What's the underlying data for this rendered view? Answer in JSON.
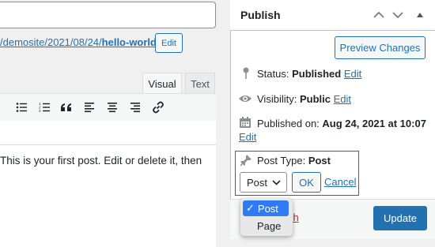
{
  "editor": {
    "permalink_prefix": "/demosite/2021/08/24/",
    "permalink_slug": "hello-world",
    "permalink_suffix": "/",
    "edit_label": "Edit",
    "tabs": {
      "visual": "Visual",
      "text": "Text"
    },
    "toolbar_icons": [
      "bulleted-list-icon",
      "numbered-list-icon",
      "blockquote-icon",
      "align-left-icon",
      "align-center-icon",
      "align-right-icon",
      "link-icon"
    ],
    "content": "This is your first post. Edit or delete it, then"
  },
  "publish": {
    "title": "Publish",
    "preview_label": "Preview Changes",
    "status_label": "Status:",
    "status_value": "Published",
    "visibility_label": "Visibility:",
    "visibility_value": "Public",
    "published_label": "Published on:",
    "published_value": "Aug 24, 2021 at 10:07",
    "edit_link": "Edit",
    "post_type_label": "Post Type:",
    "post_type_value": "Post",
    "select_value": "Post",
    "ok_label": "OK",
    "cancel_label": "Cancel",
    "trash_fragment": "sh",
    "update_label": "Update"
  },
  "dropdown": {
    "options": [
      "Post",
      "Page"
    ],
    "selected_index": 0,
    "check": "✓"
  },
  "colors": {
    "accent": "#2271b1",
    "highlight_border": "#b32d55",
    "dropdown_selected": "#2f7bf5",
    "trash": "#b32d2e"
  }
}
